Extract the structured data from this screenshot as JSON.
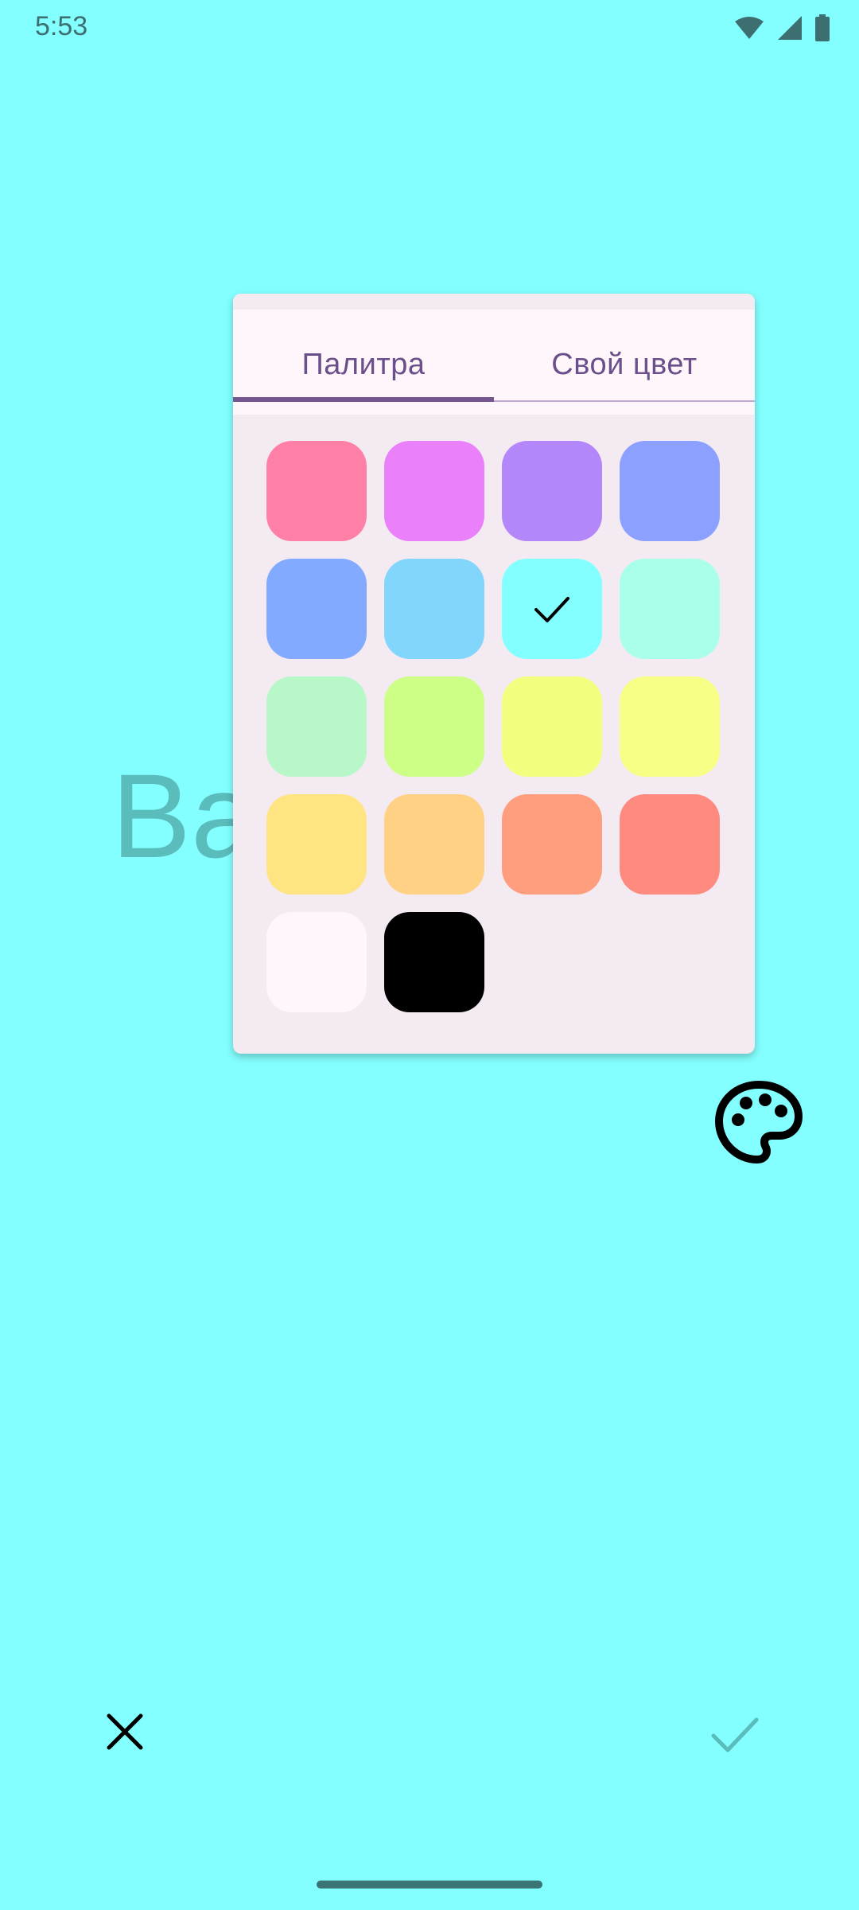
{
  "status_bar": {
    "time": "5:53",
    "icons": [
      "wifi-icon",
      "signal-icon",
      "battery-icon"
    ]
  },
  "background": {
    "color": "#84FFFF",
    "text": "Ba"
  },
  "color_picker": {
    "tabs": [
      {
        "label": "Палитра",
        "selected": true
      },
      {
        "label": "Свой цвет",
        "selected": false
      }
    ],
    "swatches": [
      {
        "color": "#FF80A6",
        "selected": false
      },
      {
        "color": "#EB80FB",
        "selected": false
      },
      {
        "color": "#B386F9",
        "selected": false
      },
      {
        "color": "#8CA0FF",
        "selected": false
      },
      {
        "color": "#82ABFF",
        "selected": false
      },
      {
        "color": "#82D5FB",
        "selected": false
      },
      {
        "color": "#84FFFF",
        "selected": true
      },
      {
        "color": "#AAFFEA",
        "selected": false
      },
      {
        "color": "#B8F7C8",
        "selected": false
      },
      {
        "color": "#CDFF86",
        "selected": false
      },
      {
        "color": "#F2FF7E",
        "selected": false
      },
      {
        "color": "#F8FF86",
        "selected": false
      },
      {
        "color": "#FFE582",
        "selected": false
      },
      {
        "color": "#FFD185",
        "selected": false
      },
      {
        "color": "#FF9E7E",
        "selected": false
      },
      {
        "color": "#FF8A80",
        "selected": false
      },
      {
        "color": "#FEF6FB",
        "selected": false
      },
      {
        "color": "#000000",
        "selected": false
      }
    ]
  },
  "actions": {
    "palette_icon": "palette-icon",
    "close_icon": "close-icon",
    "confirm_icon": "check-icon"
  }
}
